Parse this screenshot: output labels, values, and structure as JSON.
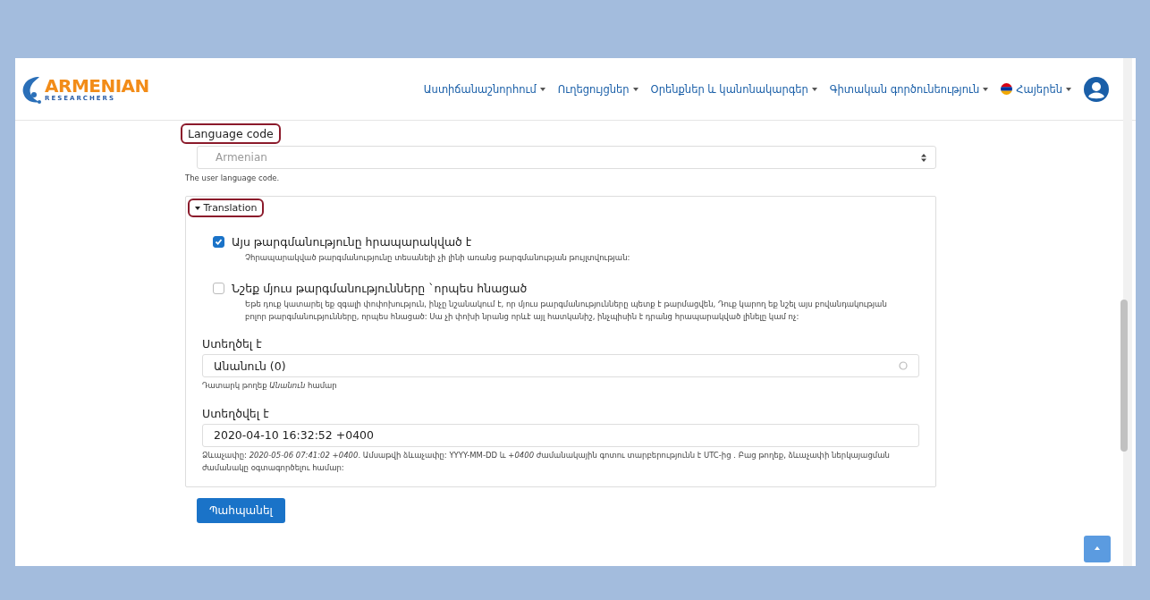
{
  "logo": {
    "title": "ARMENIAN",
    "subtitle": "RESEARCHERS"
  },
  "nav": [
    {
      "label": "Աստիճանաշնորհում"
    },
    {
      "label": "Ուղեցույցներ"
    },
    {
      "label": "Օրենքներ և կանոնակարգեր"
    },
    {
      "label": "Գիտական գործունեություն"
    },
    {
      "label": "Հայերեն",
      "kind": "language"
    }
  ],
  "language_code": {
    "label": "Language code",
    "value": "Armenian",
    "disabled": true,
    "help": "The user language code.",
    "highlighted": true
  },
  "translation": {
    "summary": "Translation",
    "expanded": true,
    "highlighted": true,
    "checkboxes": [
      {
        "label": "Այս թարգմանությունը հրապարակված է",
        "checked": true,
        "help": "Չհրապարակված թարգմանությունը տեսանելի չի լինի առանց թարգմանության թույլտվության:"
      },
      {
        "label": "Նշեք մյուս թարգմանությունները `որպես հնացած",
        "checked": false,
        "help": "Եթե դուք կատարել եք զգալի փոփոխություն, ինչը նշանակում է, որ մյուս թարգմանությունները պետք է թարմացվեն, Դուք կարող եք նշել այս բովանդակության բոլոր թարգմանությունները, որպես հնացած: Սա չի փոխի նրանց որևէ այլ հատկանիշ, ինչպիսին է դրանց հրապարակված լինելը կամ ոչ:"
      }
    ],
    "fields": [
      {
        "label": "Ստեղծել է",
        "value": "Անանուն (0)",
        "kind": "autocomplete",
        "help": "Դատարկ թողեք *Անանուն* համար"
      },
      {
        "label": "Ստեղծվել է",
        "value": "2020-04-10 16:32:52 +0400",
        "kind": "text",
        "help": "Ձևաչափը: *2020-05-06 07:41:02 +0400*. Ամսաթվի ձևաչափը: YYYY-MM-DD և *+0400* ժամանակային գոտու տարբերությունն է UTC-ից . Բաց թողեք, ձևաչափի ներկայացման ժամանակը օգտագործելու համար:"
      }
    ]
  },
  "save_button": "Պահպանել"
}
